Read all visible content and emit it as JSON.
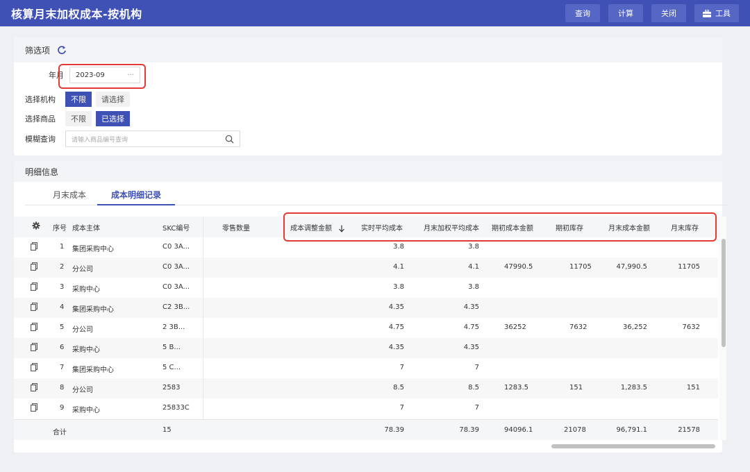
{
  "header": {
    "title": "核算月末加权成本-按机构",
    "buttons": {
      "query": "查询",
      "calc": "计算",
      "close": "关闭",
      "tools": "工具"
    }
  },
  "filter": {
    "title": "筛选项",
    "year_month": {
      "label": "年月",
      "value": "2023-09",
      "dots": "···"
    },
    "org": {
      "label": "选择机构",
      "options": [
        "不限",
        "请选择"
      ],
      "active": 0
    },
    "goods": {
      "label": "选择商品",
      "options": [
        "不限",
        "已选择"
      ],
      "active": 1
    },
    "fuzzy": {
      "label": "模糊查询",
      "placeholder": "请输入商品编号查询"
    }
  },
  "detail": {
    "title": "明细信息",
    "tabs": [
      {
        "label": "月末成本"
      },
      {
        "label": "成本明细记录",
        "active": true
      }
    ]
  },
  "table": {
    "columns": [
      "序号",
      "成本主体",
      "SKC编号",
      "零售数量",
      "成本调整金额",
      "实时平均成本",
      "月末加权平均成本",
      "期初成本金额",
      "期初库存",
      "月末成本金额",
      "月末库存"
    ],
    "rows": [
      {
        "no": "1",
        "entity": "集团采购中心",
        "skc": "C0   3A...",
        "retail_qty": "",
        "adj": "",
        "avg_cost": "3.8",
        "weighted_avg": "3.8",
        "open_amt": "",
        "open_stock": "",
        "end_amt": "",
        "end_stock": ""
      },
      {
        "no": "2",
        "entity": "分公司",
        "skc": "C0   3A...",
        "retail_qty": "",
        "adj": "",
        "avg_cost": "4.1",
        "weighted_avg": "4.1",
        "open_amt": "47990.5",
        "open_stock": "11705",
        "end_amt": "47,990.5",
        "end_stock": "11705"
      },
      {
        "no": "3",
        "entity": "采购中心",
        "skc": "C0  3A...",
        "retail_qty": "",
        "adj": "",
        "avg_cost": "3.8",
        "weighted_avg": "3.8",
        "open_amt": "",
        "open_stock": "",
        "end_amt": "",
        "end_stock": ""
      },
      {
        "no": "4",
        "entity": "集团采购中心",
        "skc": "C2   3B...",
        "retail_qty": "",
        "adj": "",
        "avg_cost": "4.35",
        "weighted_avg": "4.35",
        "open_amt": "",
        "open_stock": "",
        "end_amt": "",
        "end_stock": ""
      },
      {
        "no": "5",
        "entity": "分公司",
        "skc": "2   3B...",
        "retail_qty": "",
        "adj": "",
        "avg_cost": "4.75",
        "weighted_avg": "4.75",
        "open_amt": "36252",
        "open_stock": "7632",
        "end_amt": "36,252",
        "end_stock": "7632"
      },
      {
        "no": "6",
        "entity": "采购中心",
        "skc": "5   B...",
        "retail_qty": "",
        "adj": "",
        "avg_cost": "4.35",
        "weighted_avg": "4.35",
        "open_amt": "",
        "open_stock": "",
        "end_amt": "",
        "end_stock": ""
      },
      {
        "no": "7",
        "entity": "集团采购中心",
        "skc": "5   C...",
        "retail_qty": "",
        "adj": "",
        "avg_cost": "7",
        "weighted_avg": "7",
        "open_amt": "",
        "open_stock": "",
        "end_amt": "",
        "end_stock": ""
      },
      {
        "no": "8",
        "entity": "分公司",
        "skc": "2583",
        "retail_qty": "",
        "adj": "",
        "avg_cost": "8.5",
        "weighted_avg": "8.5",
        "open_amt": "1283.5",
        "open_stock": "151",
        "end_amt": "1,283.5",
        "end_stock": "151"
      },
      {
        "no": "9",
        "entity": "采购中心",
        "skc": "25833C",
        "retail_qty": "",
        "adj": "",
        "avg_cost": "7",
        "weighted_avg": "7",
        "open_amt": "",
        "open_stock": "",
        "end_amt": "",
        "end_stock": ""
      }
    ],
    "summary": {
      "label": "合计",
      "skc_count": "15",
      "avg_cost": "78.39",
      "weighted_avg": "78.39",
      "open_amt": "94096.1",
      "open_stock": "21078",
      "end_amt": "96,791.1",
      "end_stock": "21578"
    }
  },
  "colors": {
    "primary": "#3f51b5",
    "highlight": "#e53935"
  }
}
